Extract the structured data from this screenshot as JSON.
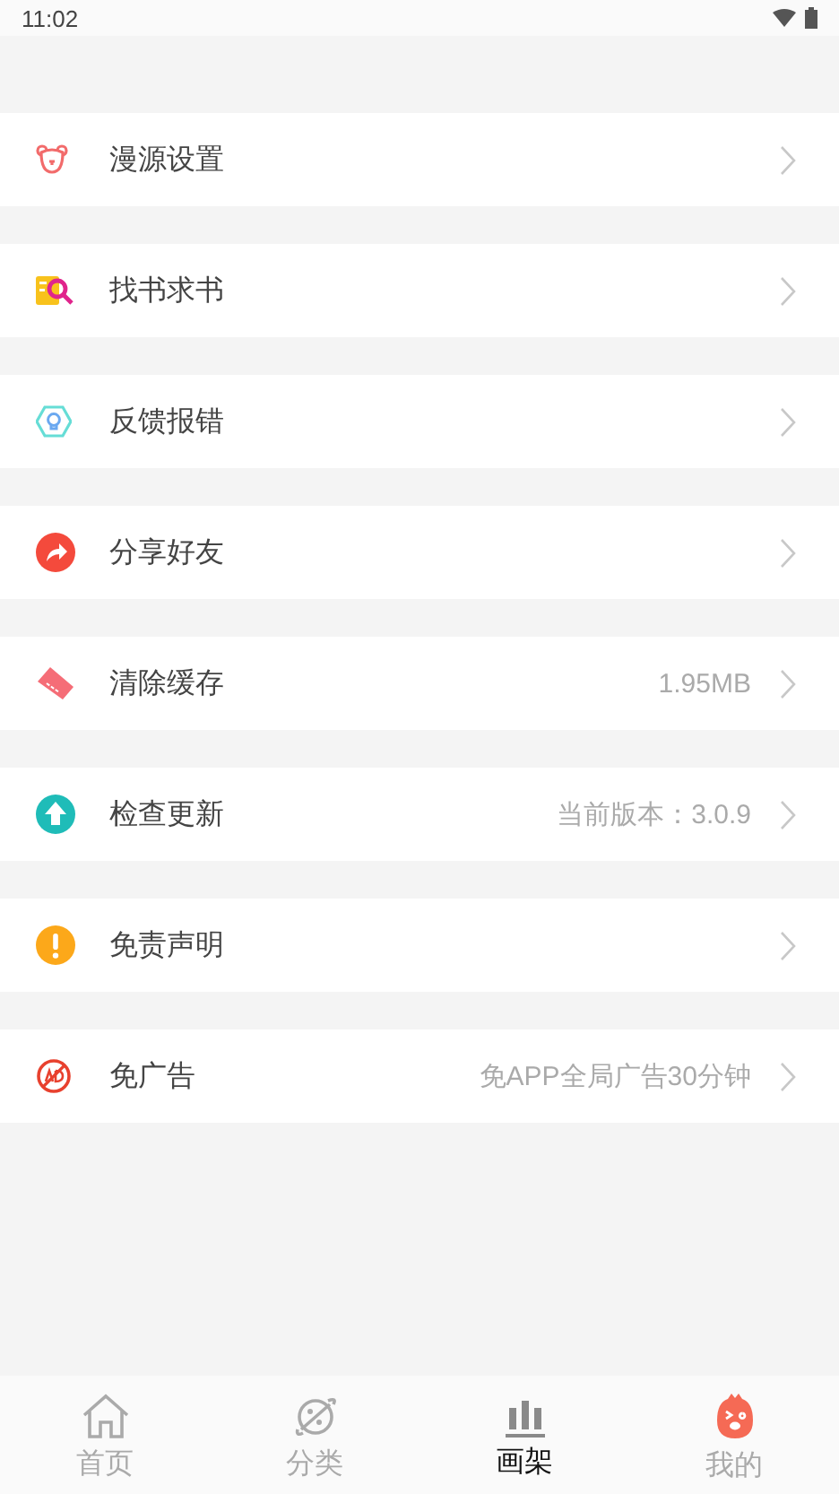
{
  "status_bar": {
    "time": "11:02"
  },
  "menu": [
    {
      "label": "漫源设置"
    },
    {
      "label": "找书求书"
    },
    {
      "label": "反馈报错"
    },
    {
      "label": "分享好友"
    },
    {
      "label": "清除缓存",
      "detail": "1.95MB"
    },
    {
      "label": "检查更新",
      "detail": "当前版本：3.0.9"
    },
    {
      "label": "免责声明"
    },
    {
      "label": "免广告",
      "detail": "免APP全局广告30分钟"
    }
  ],
  "tabs": [
    {
      "label": "首页",
      "selected": false
    },
    {
      "label": "分类",
      "selected": false
    },
    {
      "label": "画架",
      "selected": true
    },
    {
      "label": "我的",
      "selected": false
    }
  ]
}
